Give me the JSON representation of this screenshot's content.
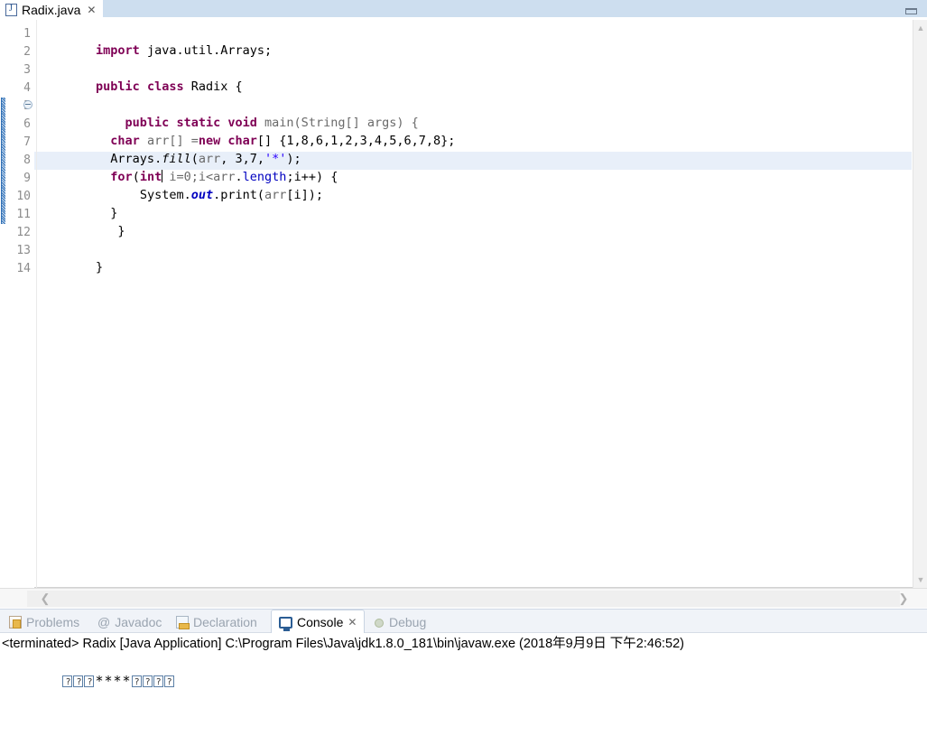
{
  "window": {
    "minimize_label": "minimize"
  },
  "editor_tab": {
    "file_name": "Radix.java",
    "file_icon": "java-file-icon",
    "close_icon": "✕"
  },
  "editor": {
    "gutter_numbers": [
      "1",
      "2",
      "3",
      "4",
      "5",
      "6",
      "7",
      "8",
      "9",
      "10",
      "11",
      "12",
      "13",
      "14"
    ],
    "current_line": 8,
    "fold_marker_line": 5,
    "change_bar_lines": "5-11",
    "lines": [
      {
        "n": 1,
        "text": "import java.util.Arrays;"
      },
      {
        "n": 2,
        "text": ""
      },
      {
        "n": 3,
        "text": "public class Radix {"
      },
      {
        "n": 4,
        "text": ""
      },
      {
        "n": 5,
        "text": "    public static void main(String[] args) {"
      },
      {
        "n": 6,
        "text": "  char arr[] =new char[] {1,8,6,1,2,3,4,5,6,7,8};"
      },
      {
        "n": 7,
        "text": "  Arrays.fill(arr, 3,7,'*');"
      },
      {
        "n": 8,
        "text": "  for(int i=0;i<arr.length;i++) {"
      },
      {
        "n": 9,
        "text": "      System.out.print(arr[i]);"
      },
      {
        "n": 10,
        "text": "  }"
      },
      {
        "n": 11,
        "text": "   }"
      },
      {
        "n": 12,
        "text": ""
      },
      {
        "n": 13,
        "text": "}"
      },
      {
        "n": 14,
        "text": ""
      }
    ],
    "tokens": {
      "import": "import",
      "java_util_arrays": " java.util.Arrays;",
      "public": "public",
      "class": "class",
      "radix": " Radix {",
      "static": "static",
      "void": "void",
      "main_sig": "main(String[] args) {",
      "char": "char",
      "arr_decl": " arr[] =",
      "new": "new",
      "char2": "char",
      "array_init": "[] {1,8,6,1,2,3,4,5,6,7,8};",
      "arrays_obj": "Arrays.",
      "fill": "fill",
      "fill_args_a": "(",
      "fill_arr": "arr",
      "fill_args_b": ", 3,7,",
      "star_literal": "'*'",
      "fill_args_c": ");",
      "for": "for",
      "for_open": "(",
      "int": "int",
      "for_init": " i=0;i<",
      "for_arr": "arr",
      "dot": ".",
      "length": "length",
      "for_rest": ";i++) {",
      "system": "System.",
      "out": "out",
      "print_open": ".print(",
      "print_arr": "arr",
      "print_idx": "[i]);",
      "brace_close": "}",
      "brace_close_indent": " }",
      "brace_final": "}"
    },
    "scrollbar": {
      "up_arrow": "▲",
      "down_arrow": "▼",
      "left_arrow": "❮",
      "right_arrow": "❯"
    }
  },
  "bottom_view": {
    "tabs": [
      {
        "label": "Problems",
        "icon": "problems-icon",
        "active": false,
        "closeable": false
      },
      {
        "label": "Javadoc",
        "icon": "javadoc-icon",
        "active": false,
        "closeable": false
      },
      {
        "label": "Declaration",
        "icon": "declaration-icon",
        "active": false,
        "closeable": false
      },
      {
        "label": "Console",
        "icon": "console-icon",
        "active": true,
        "closeable": true
      },
      {
        "label": "Debug",
        "icon": "debug-icon",
        "active": false,
        "closeable": false
      }
    ],
    "close_icon": "✕"
  },
  "console": {
    "header": "<terminated> Radix [Java Application] C:\\Program Files\\Java\\jdk1.8.0_181\\bin\\javaw.exe (2018年9月9日 下午2:46:52)",
    "output": {
      "leading_boxes": 3,
      "stars": "****",
      "trailing_boxes": 4,
      "raw": "\u0001\b\u0006****\u0005\u0006\u0007\b"
    }
  },
  "colors": {
    "tab_bar": "#cddeef",
    "keyword": "#7f0055",
    "string": "#2a00ff",
    "field": "#0000c0",
    "local_var": "#6a6a6a",
    "current_line_highlight": "#e8eff9",
    "change_bar": "#2f6fb5",
    "view_tabbar_bg": "#f0f3f8"
  }
}
